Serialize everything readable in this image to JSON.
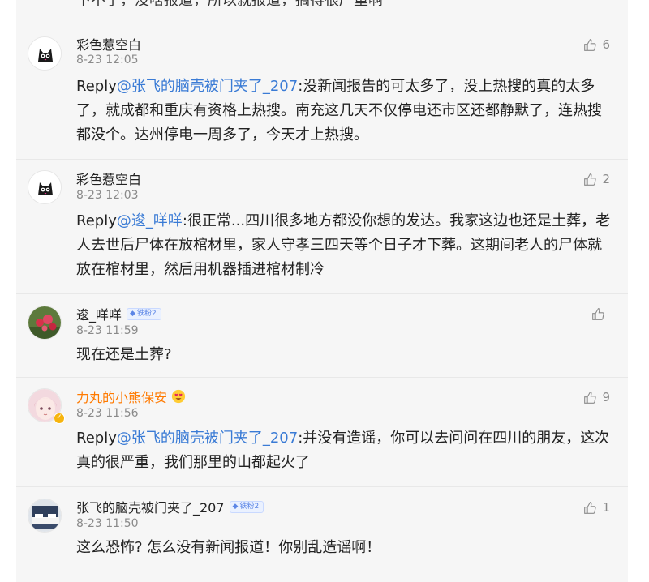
{
  "top_cut_text": "下不了，没啥报道，所以就报道，搞得很严重啊",
  "comments": [
    {
      "user": "彩色惹空白",
      "time": "8-23 12:05",
      "likes": "6",
      "reply_prefix": "Reply",
      "mention": "@张飞的脑壳被门夹了_207",
      "text": ":没新闻报告的可太多了，没上热搜的真的太多了，就成都和重庆有资格上热搜。南充这几天不仅停电还市区还都静默了，连热搜都没个。达州停电一周多了，今天才上热搜。",
      "avatar_icon": "cat-avatar"
    },
    {
      "user": "彩色惹空白",
      "time": "8-23 12:03",
      "likes": "2",
      "reply_prefix": "Reply",
      "mention": "@逡_咩咩",
      "text": ":很正常...四川很多地方都没你想的发达。我家这边也还是土葬，老人去世后尸体在放棺材里，家人守孝三四天等个日子才下葬。这期间老人的尸体就放在棺材里，然后用机器插进棺材制冷",
      "avatar_icon": "cat-avatar"
    },
    {
      "user": "逡_咩咩",
      "fan_badge": "铁粉2",
      "time": "8-23 11:59",
      "likes": "",
      "text": "现在还是土葬?",
      "avatar_icon": "flower-avatar"
    },
    {
      "user": "力丸的小熊保安",
      "time": "8-23 11:56",
      "likes": "9",
      "reply_prefix": "Reply",
      "mention": "@张飞的脑壳被门夹了_207",
      "text": ":并没有造谣，你可以去问问在四川的朋友，这次真的很严重，我们那里的山都起火了",
      "avatar_icon": "anime-girl-avatar",
      "verified_icon": "v-badge-icon",
      "emoji_icon": "heart-eyes-emoji"
    },
    {
      "user": "张飞的脑壳被门夹了_207",
      "fan_badge": "铁粉2",
      "time": "8-23 11:50",
      "likes": "1",
      "text": "这么恐怖? 怎么没有新闻报道！你别乱造谣啊！",
      "avatar_icon": "bedroom-avatar"
    }
  ],
  "colors": {
    "mention": "#3a7bd5",
    "orange_name": "#ff7a00",
    "feed_bg": "#f6f6f6",
    "meta_gray": "#8a8a8a"
  }
}
